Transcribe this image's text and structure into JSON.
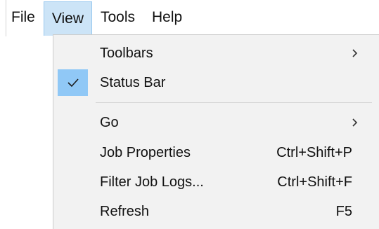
{
  "menubar": {
    "items": [
      {
        "label": "File"
      },
      {
        "label": "View",
        "active": true
      },
      {
        "label": "Tools"
      },
      {
        "label": "Help"
      }
    ]
  },
  "view_menu": {
    "items": [
      {
        "label": "Toolbars",
        "submenu": true,
        "icon": "chevron-right-icon"
      },
      {
        "label": "Status Bar",
        "checked": true,
        "icon": "checkmark-icon"
      },
      {
        "label": "Go",
        "submenu": true,
        "icon": "chevron-right-icon"
      },
      {
        "label": "Job Properties",
        "shortcut": "Ctrl+Shift+P"
      },
      {
        "label": "Filter Job Logs...",
        "shortcut": "Ctrl+Shift+F"
      },
      {
        "label": "Refresh",
        "shortcut": "F5"
      }
    ]
  },
  "colors": {
    "menubar_active_bg": "#cce4f7",
    "menubar_active_border": "#99c9ef",
    "dropdown_bg": "#f2f2f2",
    "check_highlight": "#90c8f6"
  }
}
